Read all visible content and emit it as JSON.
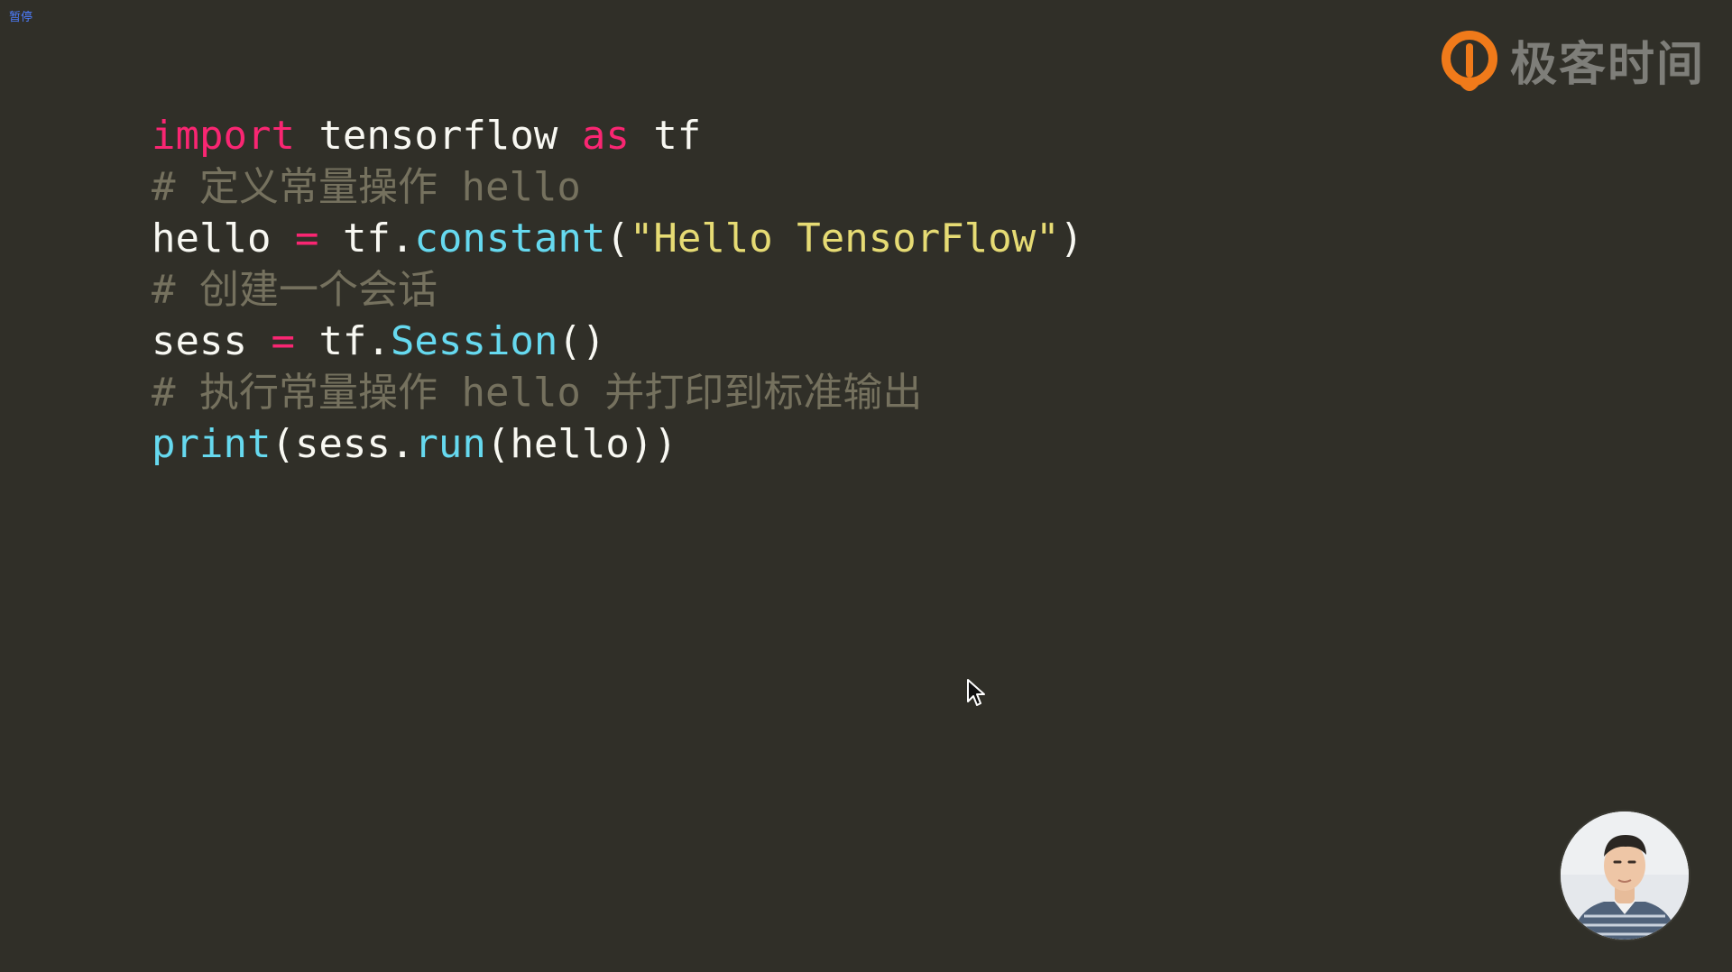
{
  "status": {
    "pause_label": "暂停"
  },
  "brand": {
    "name": "极客时间",
    "accent_color": "#f07a1a",
    "text_color": "#7e7e79"
  },
  "editor": {
    "background": "#302f28",
    "lines": [
      [
        {
          "text": "import",
          "cls": "kw"
        },
        {
          "text": " tensorflow ",
          "cls": "pl"
        },
        {
          "text": "as",
          "cls": "kw"
        },
        {
          "text": " tf",
          "cls": "pl"
        }
      ],
      [
        {
          "text": "# 定义常量操作 hello",
          "cls": "cm"
        }
      ],
      [
        {
          "text": "hello ",
          "cls": "pl"
        },
        {
          "text": "=",
          "cls": "kw"
        },
        {
          "text": " tf.",
          "cls": "pl"
        },
        {
          "text": "constant",
          "cls": "fn"
        },
        {
          "text": "(",
          "cls": "pl"
        },
        {
          "text": "\"Hello TensorFlow\"",
          "cls": "st"
        },
        {
          "text": ")",
          "cls": "pl"
        }
      ],
      [
        {
          "text": "# 创建一个会话",
          "cls": "cm"
        }
      ],
      [
        {
          "text": "sess ",
          "cls": "pl"
        },
        {
          "text": "=",
          "cls": "kw"
        },
        {
          "text": " tf.",
          "cls": "pl"
        },
        {
          "text": "Session",
          "cls": "fn"
        },
        {
          "text": "()",
          "cls": "pl"
        }
      ],
      [
        {
          "text": "# 执行常量操作 hello 并打印到标准输出",
          "cls": "cm"
        }
      ],
      [
        {
          "text": "print",
          "cls": "fn"
        },
        {
          "text": "(sess.",
          "cls": "pl"
        },
        {
          "text": "run",
          "cls": "fn"
        },
        {
          "text": "(hello))",
          "cls": "pl"
        }
      ]
    ]
  },
  "icons": {
    "cursor": "mouse-pointer-icon",
    "logo": "geektime-logo-icon",
    "presenter": "presenter-avatar"
  }
}
